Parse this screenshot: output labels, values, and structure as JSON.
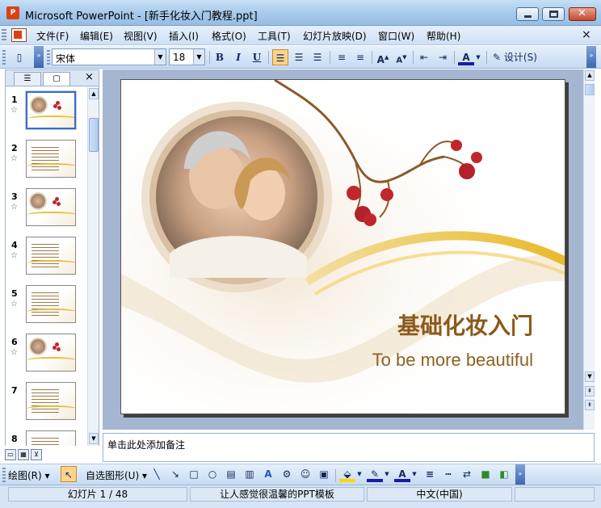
{
  "window": {
    "title": "Microsoft PowerPoint - [新手化妆入门教程.ppt]",
    "app_icon_text": "P",
    "close_glyph": "✕"
  },
  "menu": {
    "items": [
      "文件(F)",
      "编辑(E)",
      "视图(V)",
      "插入(I)",
      "格式(O)",
      "工具(T)",
      "幻灯片放映(D)",
      "窗口(W)",
      "帮助(H)"
    ],
    "close_glyph": "×"
  },
  "toolbar": {
    "font_name": "宋体",
    "font_size": "18",
    "bold": "B",
    "italic": "I",
    "underline": "U",
    "design_label": "设计(S)"
  },
  "outline": {
    "close_glyph": "×",
    "slide_numbers": [
      "1",
      "2",
      "3",
      "4",
      "5",
      "6",
      "7",
      "8"
    ],
    "star_glyph": "☆"
  },
  "slide": {
    "title": "基础化妆入门",
    "subtitle": "To be more beautiful"
  },
  "notes": {
    "placeholder": "单击此处添加备注"
  },
  "drawing": {
    "draw_label": "绘图(R)",
    "autoshapes_label": "自选图形(U)"
  },
  "status": {
    "slide_counter": "幻灯片 1 / 48",
    "template": "让人感觉很温馨的PPT模板",
    "language": "中文(中国)"
  },
  "colors": {
    "title_gold": "#8a5a1a",
    "berry_red": "#c0262c",
    "wave_gold": "#e6bf3d",
    "selection_blue": "#3b6dc0"
  }
}
